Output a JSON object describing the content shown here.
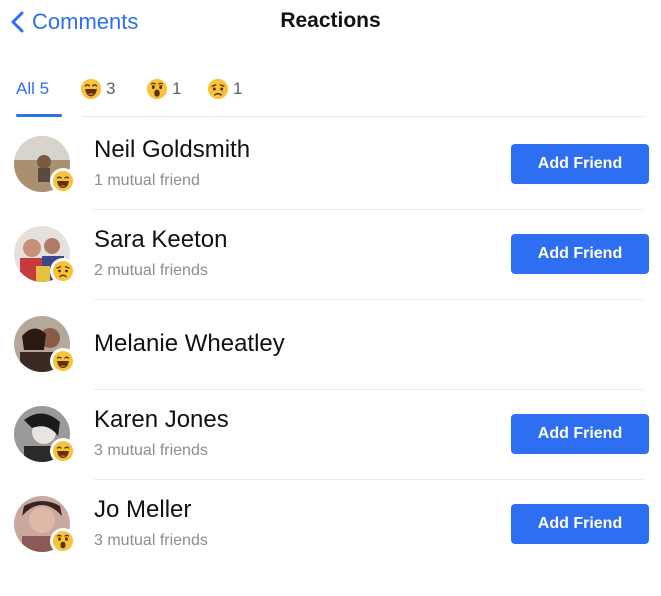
{
  "nav": {
    "back_label": "Comments",
    "title": "Reactions"
  },
  "tabs": [
    {
      "label": "All 5",
      "emoji": null
    },
    {
      "label": "3",
      "emoji": "haha"
    },
    {
      "label": "1",
      "emoji": "wow"
    },
    {
      "label": "1",
      "emoji": "sad"
    }
  ],
  "people": [
    {
      "name": "Neil Goldsmith",
      "mutual": "1 mutual friend",
      "reaction": "haha",
      "button": "Add Friend"
    },
    {
      "name": "Sara Keeton",
      "mutual": "2 mutual friends",
      "reaction": "sad",
      "button": "Add Friend"
    },
    {
      "name": "Melanie Wheatley",
      "mutual": "",
      "reaction": "haha",
      "button": ""
    },
    {
      "name": "Karen Jones",
      "mutual": "3 mutual friends",
      "reaction": "haha",
      "button": "Add Friend"
    },
    {
      "name": "Jo Meller",
      "mutual": "3 mutual friends",
      "reaction": "wow",
      "button": "Add Friend"
    }
  ],
  "colors": {
    "accent": "#2d6ff0",
    "emoji_yellow": "#f7c33b"
  }
}
